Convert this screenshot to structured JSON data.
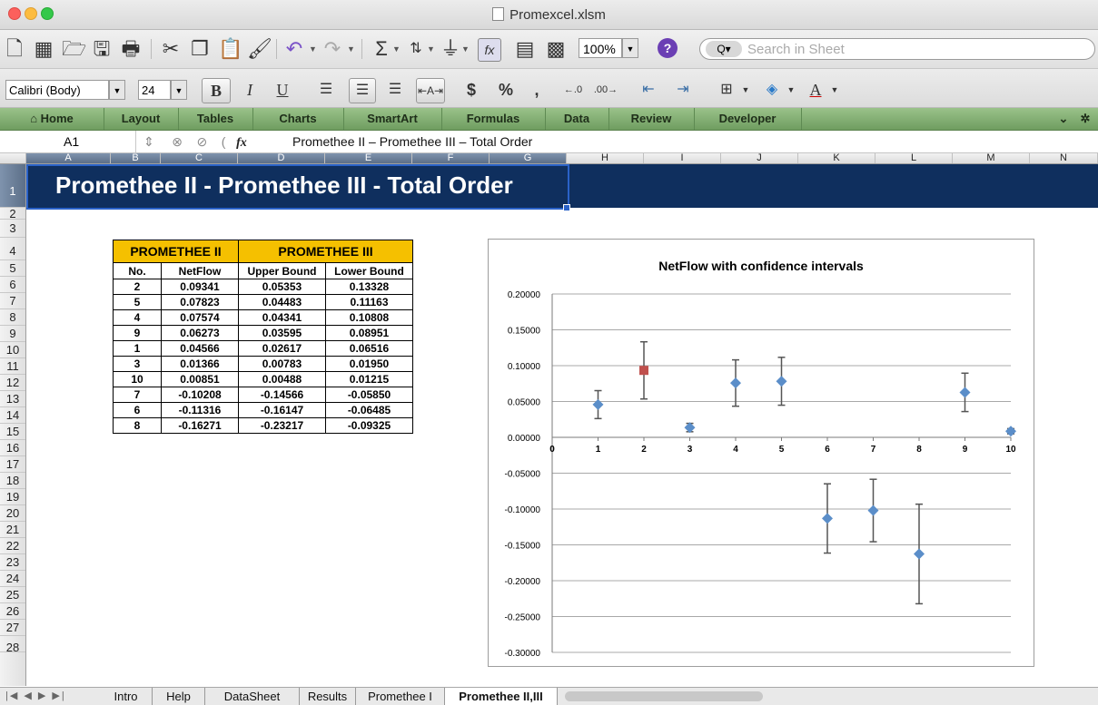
{
  "window": {
    "title": "Promexcel.xlsm"
  },
  "toolbar": {
    "zoom": "100%",
    "search_placeholder": "Search in Sheet"
  },
  "format": {
    "font": "Calibri (Body)",
    "size": "24",
    "bold": "B",
    "italic": "I",
    "underline": "U"
  },
  "ribbon": {
    "tabs": [
      "Home",
      "Layout",
      "Tables",
      "Charts",
      "SmartArt",
      "Formulas",
      "Data",
      "Review",
      "Developer"
    ]
  },
  "formula_bar": {
    "cell": "A1",
    "fx": "fx",
    "value": "Promethee II – Promethee III – Total Order"
  },
  "columns": [
    "A",
    "B",
    "C",
    "D",
    "E",
    "F",
    "G",
    "H",
    "I",
    "J",
    "K",
    "L",
    "M",
    "N"
  ],
  "rows": [
    "1",
    "2",
    "3",
    "4",
    "5",
    "6",
    "7",
    "8",
    "9",
    "10",
    "11",
    "12",
    "13",
    "14",
    "15",
    "16",
    "17",
    "18",
    "19",
    "20",
    "21",
    "22",
    "23",
    "24",
    "25",
    "26",
    "27",
    "28"
  ],
  "sheet_title": "Promethee II - Promethee III - Total Order",
  "table": {
    "group_headers": [
      "PROMETHEE II",
      "PROMETHEE III"
    ],
    "col_headers": [
      "No.",
      "NetFlow",
      "Upper Bound",
      "Lower Bound"
    ],
    "rows": [
      [
        "2",
        "0.09341",
        "0.05353",
        "0.13328"
      ],
      [
        "5",
        "0.07823",
        "0.04483",
        "0.11163"
      ],
      [
        "4",
        "0.07574",
        "0.04341",
        "0.10808"
      ],
      [
        "9",
        "0.06273",
        "0.03595",
        "0.08951"
      ],
      [
        "1",
        "0.04566",
        "0.02617",
        "0.06516"
      ],
      [
        "3",
        "0.01366",
        "0.00783",
        "0.01950"
      ],
      [
        "10",
        "0.00851",
        "0.00488",
        "0.01215"
      ],
      [
        "7",
        "-0.10208",
        "-0.14566",
        "-0.05850"
      ],
      [
        "6",
        "-0.11316",
        "-0.16147",
        "-0.06485"
      ],
      [
        "8",
        "-0.16271",
        "-0.23217",
        "-0.09325"
      ]
    ]
  },
  "chart_data": {
    "type": "scatter",
    "title": "NetFlow with confidence intervals",
    "xlim": [
      0,
      10
    ],
    "ylim": [
      -0.3,
      0.2
    ],
    "x_ticks": [
      "0",
      "1",
      "2",
      "3",
      "4",
      "5",
      "6",
      "7",
      "8",
      "9",
      "10"
    ],
    "y_ticks": [
      "0.20000",
      "0.15000",
      "0.10000",
      "0.05000",
      "0.00000",
      "-0.05000",
      "-0.10000",
      "-0.15000",
      "-0.20000",
      "-0.25000",
      "-0.30000"
    ],
    "grid": true,
    "points": [
      {
        "x": 1,
        "y": 0.04566,
        "low": 0.02617,
        "high": 0.06516
      },
      {
        "x": 2,
        "y": 0.09341,
        "low": 0.05353,
        "high": 0.13328,
        "highlight": true
      },
      {
        "x": 3,
        "y": 0.01366,
        "low": 0.00783,
        "high": 0.0195
      },
      {
        "x": 4,
        "y": 0.07574,
        "low": 0.04341,
        "high": 0.10808
      },
      {
        "x": 5,
        "y": 0.07823,
        "low": 0.04483,
        "high": 0.11163
      },
      {
        "x": 6,
        "y": -0.11316,
        "low": -0.16147,
        "high": -0.06485
      },
      {
        "x": 7,
        "y": -0.10208,
        "low": -0.14566,
        "high": -0.0585
      },
      {
        "x": 8,
        "y": -0.16271,
        "low": -0.23217,
        "high": -0.09325
      },
      {
        "x": 9,
        "y": 0.06273,
        "low": 0.03595,
        "high": 0.08951
      },
      {
        "x": 10,
        "y": 0.00851,
        "low": 0.00488,
        "high": 0.01215
      }
    ],
    "marker_color": "#5b8ec9",
    "highlight_color": "#c0504d"
  },
  "sheet_tabs": {
    "tabs": [
      "Intro",
      "Help",
      "DataSheet",
      "Results",
      "Promethee I",
      "Promethee II,III"
    ],
    "active": "Promethee II,III"
  },
  "colors": {
    "banner": "#0f2f5e",
    "table_header": "#f5c000",
    "ribbon": "#7faa70"
  }
}
